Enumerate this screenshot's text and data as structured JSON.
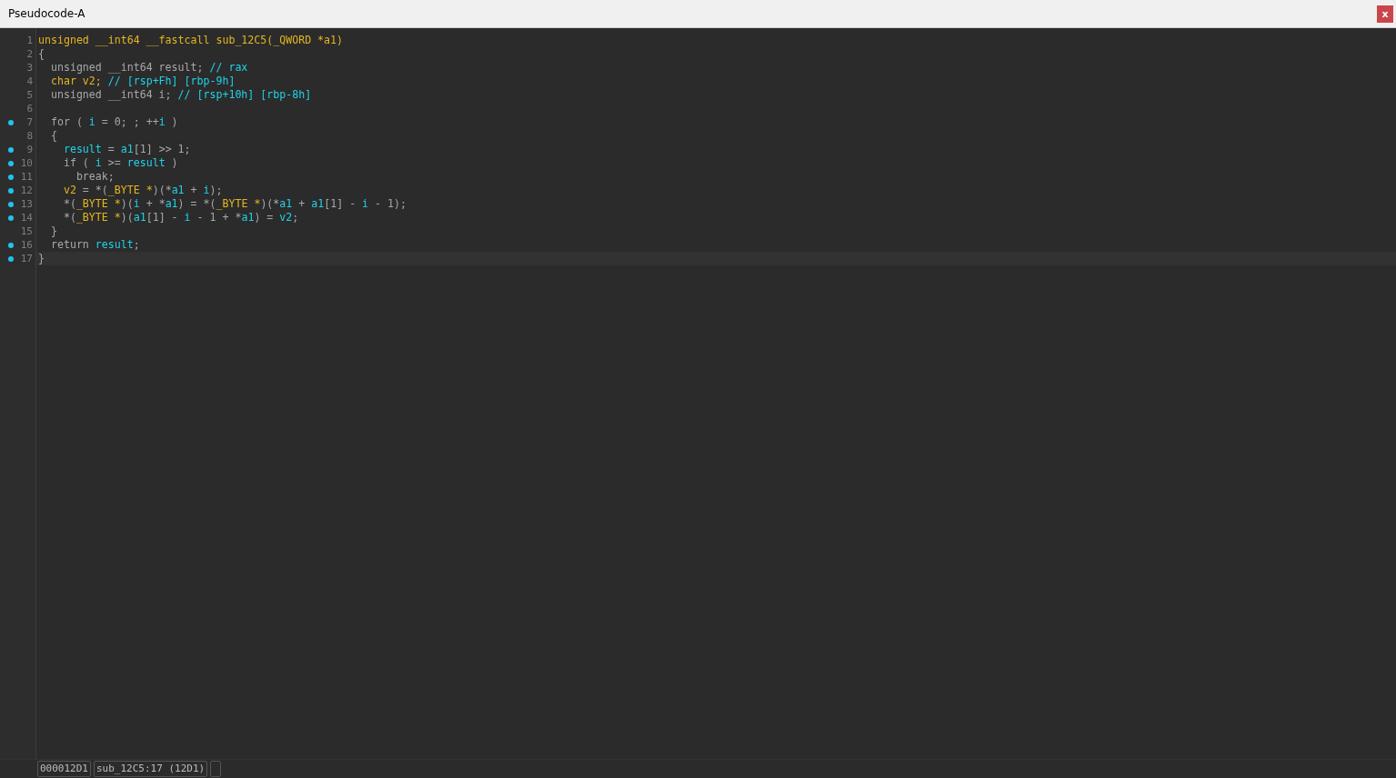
{
  "window": {
    "title": "Pseudocode-A",
    "close_label": "x"
  },
  "lines": [
    {
      "number": "1",
      "breakpoint": false,
      "selected": false,
      "tokens": [
        {
          "text": "unsigned __int64 __fastcall sub_12C5(_QWORD *a1)",
          "kind": "type"
        }
      ]
    },
    {
      "number": "2",
      "breakpoint": false,
      "selected": false,
      "tokens": [
        {
          "text": "{",
          "kind": "plain"
        }
      ]
    },
    {
      "number": "3",
      "breakpoint": false,
      "selected": false,
      "tokens": [
        {
          "text": "  unsigned __int64 result; ",
          "kind": "plain"
        },
        {
          "text": "// rax",
          "kind": "var"
        }
      ]
    },
    {
      "number": "4",
      "breakpoint": false,
      "selected": false,
      "tokens": [
        {
          "text": "  char v2; ",
          "kind": "type"
        },
        {
          "text": "// [rsp+Fh] [rbp-9h]",
          "kind": "var"
        }
      ]
    },
    {
      "number": "5",
      "breakpoint": false,
      "selected": false,
      "tokens": [
        {
          "text": "  unsigned __int64 i; ",
          "kind": "plain"
        },
        {
          "text": "// [rsp+10h] [rbp-8h]",
          "kind": "var"
        }
      ]
    },
    {
      "number": "6",
      "breakpoint": false,
      "selected": false
    },
    {
      "number": "7",
      "breakpoint": true,
      "selected": false,
      "tokens": [
        {
          "text": "  for ( ",
          "kind": "plain"
        },
        {
          "text": "i",
          "kind": "var"
        },
        {
          "text": " = 0; ; ++",
          "kind": "plain"
        },
        {
          "text": "i",
          "kind": "var"
        },
        {
          "text": " )",
          "kind": "plain"
        }
      ]
    },
    {
      "number": "8",
      "breakpoint": false,
      "selected": false,
      "tokens": [
        {
          "text": "  {",
          "kind": "plain"
        }
      ]
    },
    {
      "number": "9",
      "breakpoint": true,
      "selected": false,
      "tokens": [
        {
          "text": "    result",
          "kind": "var"
        },
        {
          "text": " = ",
          "kind": "plain"
        },
        {
          "text": "a1",
          "kind": "var"
        },
        {
          "text": "[1] >> 1;",
          "kind": "plain"
        }
      ]
    },
    {
      "number": "10",
      "breakpoint": true,
      "selected": false,
      "tokens": [
        {
          "text": "    if ( ",
          "kind": "plain"
        },
        {
          "text": "i",
          "kind": "var"
        },
        {
          "text": " >= ",
          "kind": "plain"
        },
        {
          "text": "result",
          "kind": "var"
        },
        {
          "text": " )",
          "kind": "plain"
        }
      ]
    },
    {
      "number": "11",
      "breakpoint": true,
      "selected": false,
      "tokens": [
        {
          "text": "      break;",
          "kind": "plain"
        }
      ]
    },
    {
      "number": "12",
      "breakpoint": true,
      "selected": false,
      "tokens": [
        {
          "text": "    v2",
          "kind": "type"
        },
        {
          "text": " = *(",
          "kind": "plain"
        },
        {
          "text": "_BYTE *",
          "kind": "type"
        },
        {
          "text": ")(*",
          "kind": "plain"
        },
        {
          "text": "a1",
          "kind": "var"
        },
        {
          "text": " + ",
          "kind": "plain"
        },
        {
          "text": "i",
          "kind": "var"
        },
        {
          "text": ");",
          "kind": "plain"
        }
      ]
    },
    {
      "number": "13",
      "breakpoint": true,
      "selected": false,
      "tokens": [
        {
          "text": "    *(",
          "kind": "plain"
        },
        {
          "text": "_BYTE *",
          "kind": "type"
        },
        {
          "text": ")(",
          "kind": "plain"
        },
        {
          "text": "i",
          "kind": "var"
        },
        {
          "text": " + *",
          "kind": "plain"
        },
        {
          "text": "a1",
          "kind": "var"
        },
        {
          "text": ") = *(",
          "kind": "plain"
        },
        {
          "text": "_BYTE *",
          "kind": "type"
        },
        {
          "text": ")(*",
          "kind": "plain"
        },
        {
          "text": "a1",
          "kind": "var"
        },
        {
          "text": " + ",
          "kind": "plain"
        },
        {
          "text": "a1",
          "kind": "var"
        },
        {
          "text": "[1] - ",
          "kind": "plain"
        },
        {
          "text": "i",
          "kind": "var"
        },
        {
          "text": " - 1);",
          "kind": "plain"
        }
      ]
    },
    {
      "number": "14",
      "breakpoint": true,
      "selected": false,
      "tokens": [
        {
          "text": "    *(",
          "kind": "plain"
        },
        {
          "text": "_BYTE *",
          "kind": "type"
        },
        {
          "text": ")(",
          "kind": "plain"
        },
        {
          "text": "a1",
          "kind": "var"
        },
        {
          "text": "[1] - ",
          "kind": "plain"
        },
        {
          "text": "i",
          "kind": "var"
        },
        {
          "text": " - 1 + *",
          "kind": "plain"
        },
        {
          "text": "a1",
          "kind": "var"
        },
        {
          "text": ") = ",
          "kind": "plain"
        },
        {
          "text": "v2",
          "kind": "var"
        },
        {
          "text": ";",
          "kind": "plain"
        }
      ]
    },
    {
      "number": "15",
      "breakpoint": false,
      "selected": false,
      "tokens": [
        {
          "text": "  }",
          "kind": "plain"
        }
      ]
    },
    {
      "number": "16",
      "breakpoint": true,
      "selected": false,
      "tokens": [
        {
          "text": "  return ",
          "kind": "plain"
        },
        {
          "text": "result",
          "kind": "var"
        },
        {
          "text": ";",
          "kind": "plain"
        }
      ]
    },
    {
      "number": "17",
      "breakpoint": true,
      "selected": true,
      "tokens": [
        {
          "text": "}",
          "kind": "plain"
        }
      ]
    }
  ],
  "status_bar": {
    "address": "000012D1",
    "location": "sub_12C5:17 (12D1)"
  }
}
